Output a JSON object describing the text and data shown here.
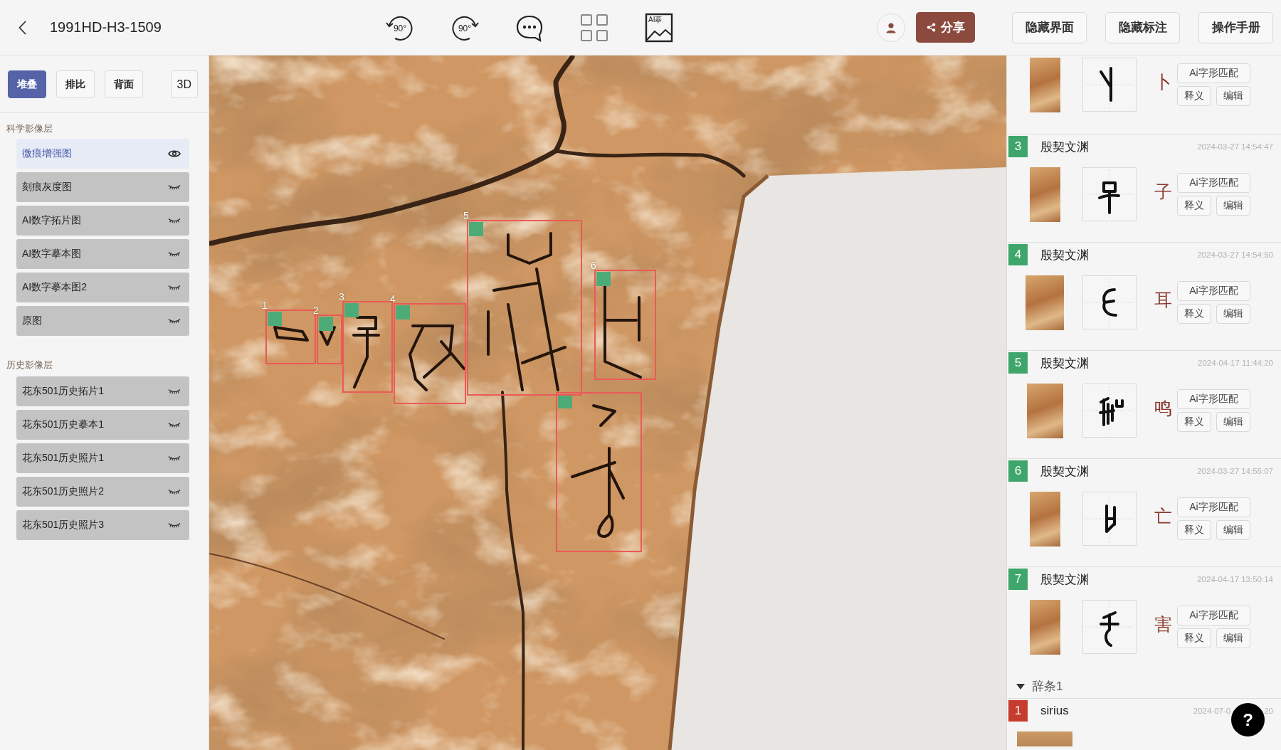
{
  "header": {
    "title": "1991HD-H3-1509",
    "tools": [
      {
        "kind": "rotate-left",
        "label": "90°"
      },
      {
        "kind": "rotate-right",
        "label": "90°"
      },
      {
        "kind": "comment"
      },
      {
        "kind": "grid"
      },
      {
        "kind": "ai-image",
        "label": "AI摹"
      }
    ],
    "share_button": "分享",
    "buttons": [
      "隐藏界面",
      "隐藏标注",
      "操作手册"
    ]
  },
  "view_modes": [
    {
      "label": "堆叠",
      "selected": true
    },
    {
      "label": "排比",
      "selected": false
    },
    {
      "label": "背面",
      "selected": false
    },
    {
      "label": "3D",
      "selected": false
    }
  ],
  "layer_groups": [
    {
      "title": "科学影像层",
      "layers": [
        {
          "name": "微痕增强图",
          "visible": true
        },
        {
          "name": "刻痕灰度图",
          "visible": false
        },
        {
          "name": "AI数字拓片图",
          "visible": false
        },
        {
          "name": "AI数字摹本图",
          "visible": false
        },
        {
          "name": "AI数字摹本图2",
          "visible": false
        },
        {
          "name": "原图",
          "visible": false
        }
      ]
    },
    {
      "title": "历史影像层",
      "layers": [
        {
          "name": "花东501历史拓片1",
          "visible": false
        },
        {
          "name": "花东501历史摹本1",
          "visible": false
        },
        {
          "name": "花东501历史照片1",
          "visible": false
        },
        {
          "name": "花东501历史照片2",
          "visible": false
        },
        {
          "name": "花东501历史照片3",
          "visible": false
        }
      ]
    }
  ],
  "annotations": [
    {
      "kind": "character",
      "label": "1"
    },
    {
      "kind": "character",
      "label": "2"
    },
    {
      "kind": "character",
      "label": "3"
    },
    {
      "kind": "character",
      "label": "4"
    },
    {
      "kind": "character",
      "label": "5"
    },
    {
      "kind": "character",
      "label": "6"
    },
    {
      "kind": "character"
    }
  ],
  "cards": [
    {
      "char": "卜",
      "buttons": [
        "Ai字形匹配",
        "释义",
        "编辑"
      ]
    },
    {
      "number": "3",
      "color": "#3fa66b",
      "source": "殷契文渊",
      "time": "2024-03-27 14:54:47",
      "char": "子",
      "buttons": [
        "Ai字形匹配",
        "释义",
        "编辑"
      ]
    },
    {
      "number": "4",
      "color": "#3fa66b",
      "source": "殷契文渊",
      "time": "2024-03-27 14:54:50",
      "char": "耳",
      "buttons": [
        "Ai字形匹配",
        "释义",
        "编辑"
      ]
    },
    {
      "number": "5",
      "color": "#3fa66b",
      "source": "殷契文渊",
      "time": "2024-04-17 11:44:20",
      "char": "鸣",
      "buttons": [
        "Ai字形匹配",
        "释义",
        "编辑"
      ]
    },
    {
      "number": "6",
      "color": "#3fa66b",
      "source": "殷契文渊",
      "time": "2024-03-27 14:55:07",
      "char": "亡",
      "buttons": [
        "Ai字形匹配",
        "释义",
        "编辑"
      ]
    },
    {
      "number": "7",
      "color": "#3fa66b",
      "source": "殷契文渊",
      "time": "2024-04-17 13:50:14",
      "char": "害",
      "buttons": [
        "Ai字形匹配",
        "释义",
        "编辑"
      ]
    }
  ],
  "entry_group": {
    "title": "辞条1",
    "expanded": true,
    "items": [
      {
        "number": "1",
        "color": "#c63c2e",
        "author": "sirius",
        "time_parts": [
          "2024-07-0",
          "20"
        ]
      }
    ]
  },
  "help_button": {
    "label": "?"
  }
}
